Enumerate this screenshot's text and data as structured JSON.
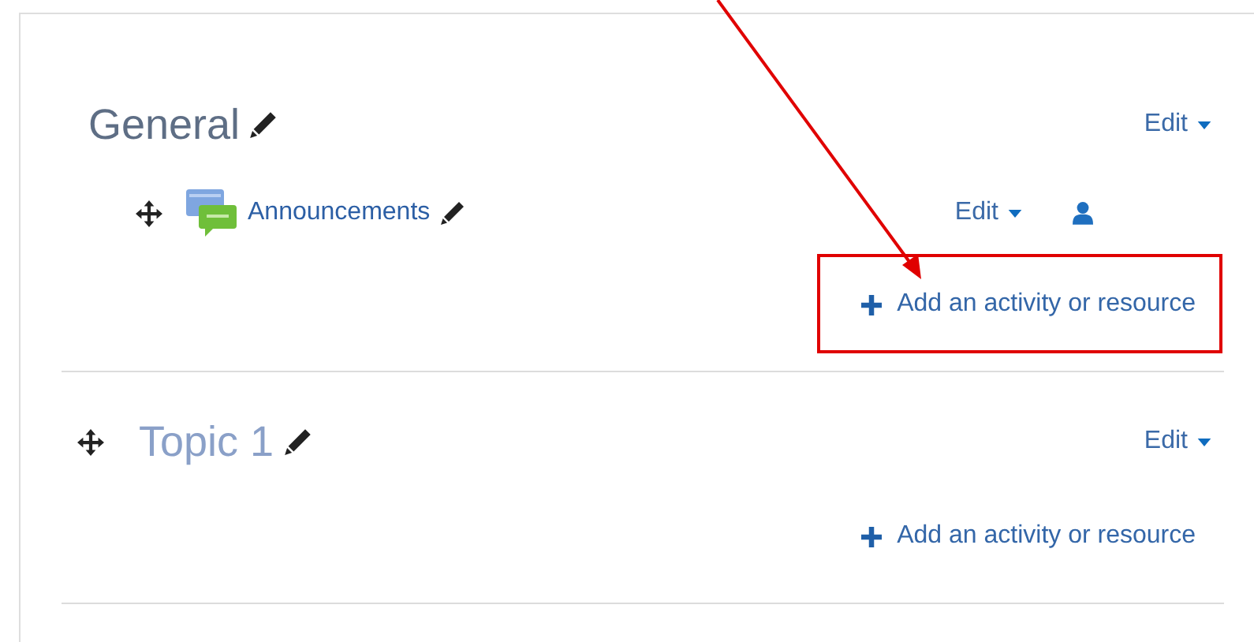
{
  "sections": [
    {
      "title": "General",
      "movable": false,
      "edit": "Edit",
      "activities": [
        {
          "name": "Announcements",
          "edit": "Edit",
          "movable": true
        }
      ],
      "add": {
        "label": "Add an activity or resource",
        "highlighted": true
      }
    },
    {
      "title": "Topic 1",
      "movable": true,
      "edit": "Edit",
      "add": {
        "label": "Add an activity or resource",
        "highlighted": false
      }
    }
  ]
}
